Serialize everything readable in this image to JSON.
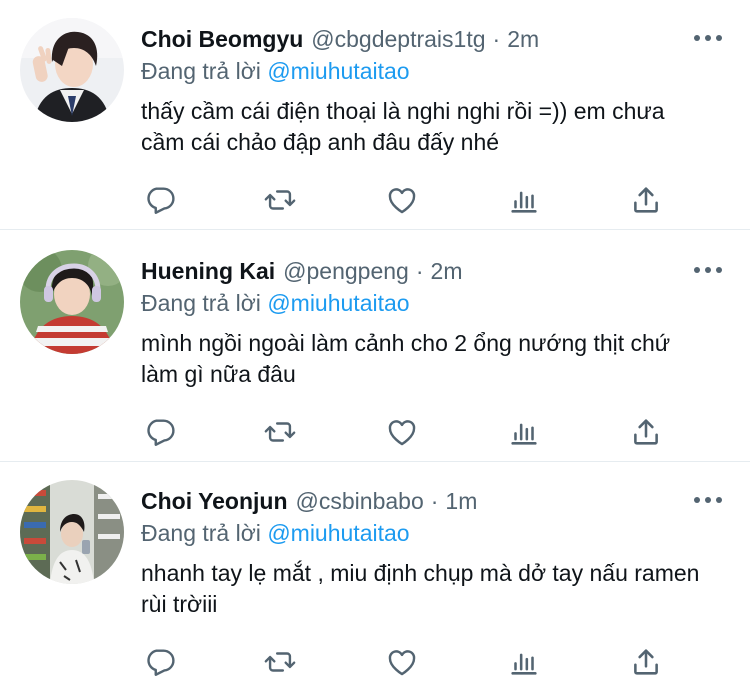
{
  "colors": {
    "text": "#0f1419",
    "secondary": "#536471",
    "link": "#1d9bf0",
    "divider": "#e6ecf0"
  },
  "tweets": [
    {
      "name": "Choi Beomgyu",
      "handle": "@cbgdeptrais1tg",
      "separator": "·",
      "time": "2m",
      "reply_prefix": "Đang trả lời",
      "reply_to": "@miuhutaitao",
      "text": "thấy cầm cái điện thoại là nghi nghi rồi =)) em chưa cầm cái chảo đập anh đâu đấy nhé",
      "avatar_icon": "profile-photo"
    },
    {
      "name": "Huening Kai",
      "handle": "@pengpeng",
      "separator": "·",
      "time": "2m",
      "reply_prefix": "Đang trả lời",
      "reply_to": "@miuhutaitao",
      "text": "mình ngồi ngoài làm cảnh cho 2 ổng nướng thịt chứ làm gì nữa đâu",
      "avatar_icon": "profile-photo"
    },
    {
      "name": "Choi Yeonjun",
      "handle": "@csbinbabo",
      "separator": "·",
      "time": "1m",
      "reply_prefix": "Đang trả lời",
      "reply_to": "@miuhutaitao",
      "text": "nhanh tay lẹ mắt , miu định chụp mà dở tay nấu ramen rùi trờiii",
      "avatar_icon": "profile-photo"
    }
  ],
  "action_icons": [
    "reply-icon",
    "retweet-icon",
    "like-icon",
    "analytics-icon",
    "share-icon"
  ]
}
